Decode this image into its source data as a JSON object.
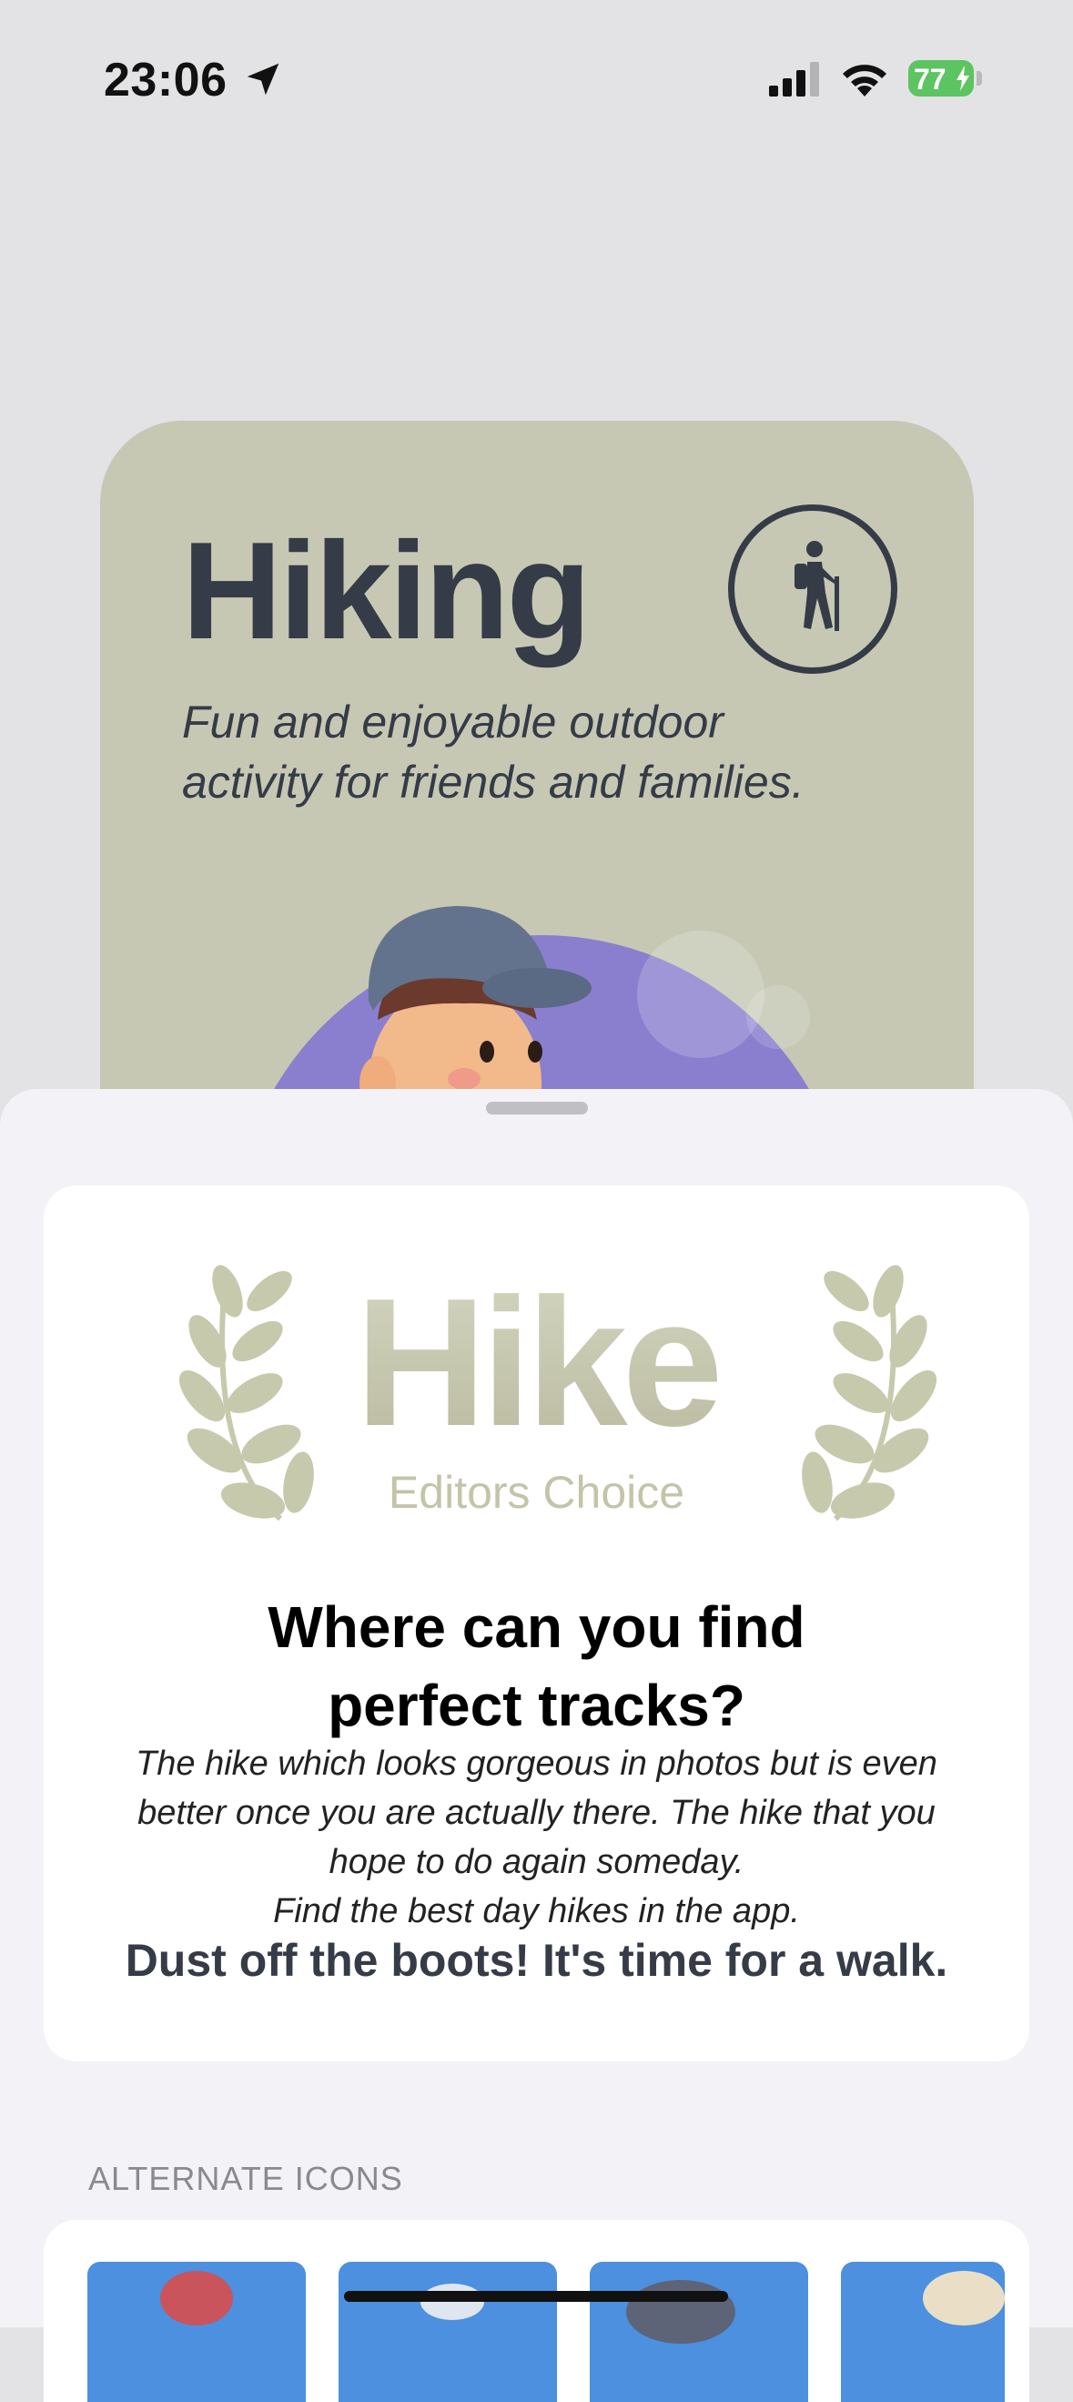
{
  "status_bar": {
    "time": "23:06",
    "battery_percent": "77",
    "charging": true
  },
  "hero": {
    "title": "Hiking",
    "subtitle": "Fun and enjoyable outdoor activity for friends and families.",
    "badge_icon": "hiker-icon"
  },
  "award": {
    "title": "Hike",
    "subtitle": "Editors Choice"
  },
  "article": {
    "headline_line1": "Where can you find",
    "headline_line2": "perfect tracks?",
    "body_line1": "The hike which looks gorgeous in photos but is even",
    "body_line2": "better once you are actually there. The hike that you",
    "body_line3": "hope to do again someday.",
    "body_line4": "Find the best day hikes in the app.",
    "cta": "Dust off the boots! It's time for a walk."
  },
  "alternate_icons": {
    "header": "ALTERNATE ICONS",
    "items": [
      "alt-icon-1",
      "alt-icon-2",
      "alt-icon-3",
      "alt-icon-4"
    ]
  },
  "colors": {
    "hero_bg": "#c6c8b4",
    "text_dark": "#353b47",
    "accent_purple": "#8a7fcf",
    "battery_green": "#5cc461"
  }
}
